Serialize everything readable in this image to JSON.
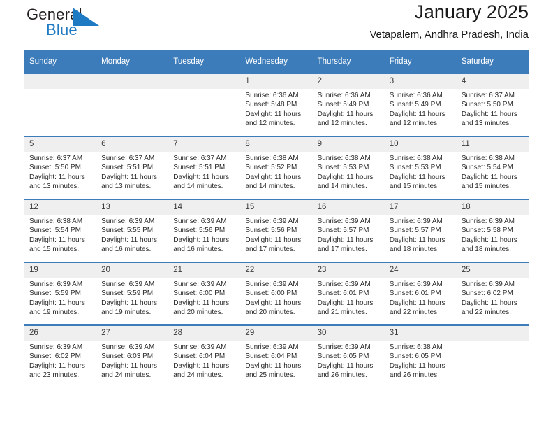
{
  "logo": {
    "word_one": "General",
    "word_two": "Blue",
    "triangle_color": "#1f7ac4",
    "text_color": "#231f20"
  },
  "header": {
    "title": "January 2025",
    "subtitle": "Vetapalem, Andhra Pradesh, India"
  },
  "theme": {
    "header_blue": "#3c7cba",
    "daynum_band": "#efefef",
    "text": "#2b2b2b"
  },
  "weekdays": [
    "Sunday",
    "Monday",
    "Tuesday",
    "Wednesday",
    "Thursday",
    "Friday",
    "Saturday"
  ],
  "weeks": [
    [
      {
        "day": "",
        "sunrise": "",
        "sunset": "",
        "daylight_1": "",
        "daylight_2": ""
      },
      {
        "day": "",
        "sunrise": "",
        "sunset": "",
        "daylight_1": "",
        "daylight_2": ""
      },
      {
        "day": "",
        "sunrise": "",
        "sunset": "",
        "daylight_1": "",
        "daylight_2": ""
      },
      {
        "day": "1",
        "sunrise": "Sunrise: 6:36 AM",
        "sunset": "Sunset: 5:48 PM",
        "daylight_1": "Daylight: 11 hours",
        "daylight_2": "and 12 minutes."
      },
      {
        "day": "2",
        "sunrise": "Sunrise: 6:36 AM",
        "sunset": "Sunset: 5:49 PM",
        "daylight_1": "Daylight: 11 hours",
        "daylight_2": "and 12 minutes."
      },
      {
        "day": "3",
        "sunrise": "Sunrise: 6:36 AM",
        "sunset": "Sunset: 5:49 PM",
        "daylight_1": "Daylight: 11 hours",
        "daylight_2": "and 12 minutes."
      },
      {
        "day": "4",
        "sunrise": "Sunrise: 6:37 AM",
        "sunset": "Sunset: 5:50 PM",
        "daylight_1": "Daylight: 11 hours",
        "daylight_2": "and 13 minutes."
      }
    ],
    [
      {
        "day": "5",
        "sunrise": "Sunrise: 6:37 AM",
        "sunset": "Sunset: 5:50 PM",
        "daylight_1": "Daylight: 11 hours",
        "daylight_2": "and 13 minutes."
      },
      {
        "day": "6",
        "sunrise": "Sunrise: 6:37 AM",
        "sunset": "Sunset: 5:51 PM",
        "daylight_1": "Daylight: 11 hours",
        "daylight_2": "and 13 minutes."
      },
      {
        "day": "7",
        "sunrise": "Sunrise: 6:37 AM",
        "sunset": "Sunset: 5:51 PM",
        "daylight_1": "Daylight: 11 hours",
        "daylight_2": "and 14 minutes."
      },
      {
        "day": "8",
        "sunrise": "Sunrise: 6:38 AM",
        "sunset": "Sunset: 5:52 PM",
        "daylight_1": "Daylight: 11 hours",
        "daylight_2": "and 14 minutes."
      },
      {
        "day": "9",
        "sunrise": "Sunrise: 6:38 AM",
        "sunset": "Sunset: 5:53 PM",
        "daylight_1": "Daylight: 11 hours",
        "daylight_2": "and 14 minutes."
      },
      {
        "day": "10",
        "sunrise": "Sunrise: 6:38 AM",
        "sunset": "Sunset: 5:53 PM",
        "daylight_1": "Daylight: 11 hours",
        "daylight_2": "and 15 minutes."
      },
      {
        "day": "11",
        "sunrise": "Sunrise: 6:38 AM",
        "sunset": "Sunset: 5:54 PM",
        "daylight_1": "Daylight: 11 hours",
        "daylight_2": "and 15 minutes."
      }
    ],
    [
      {
        "day": "12",
        "sunrise": "Sunrise: 6:38 AM",
        "sunset": "Sunset: 5:54 PM",
        "daylight_1": "Daylight: 11 hours",
        "daylight_2": "and 15 minutes."
      },
      {
        "day": "13",
        "sunrise": "Sunrise: 6:39 AM",
        "sunset": "Sunset: 5:55 PM",
        "daylight_1": "Daylight: 11 hours",
        "daylight_2": "and 16 minutes."
      },
      {
        "day": "14",
        "sunrise": "Sunrise: 6:39 AM",
        "sunset": "Sunset: 5:56 PM",
        "daylight_1": "Daylight: 11 hours",
        "daylight_2": "and 16 minutes."
      },
      {
        "day": "15",
        "sunrise": "Sunrise: 6:39 AM",
        "sunset": "Sunset: 5:56 PM",
        "daylight_1": "Daylight: 11 hours",
        "daylight_2": "and 17 minutes."
      },
      {
        "day": "16",
        "sunrise": "Sunrise: 6:39 AM",
        "sunset": "Sunset: 5:57 PM",
        "daylight_1": "Daylight: 11 hours",
        "daylight_2": "and 17 minutes."
      },
      {
        "day": "17",
        "sunrise": "Sunrise: 6:39 AM",
        "sunset": "Sunset: 5:57 PM",
        "daylight_1": "Daylight: 11 hours",
        "daylight_2": "and 18 minutes."
      },
      {
        "day": "18",
        "sunrise": "Sunrise: 6:39 AM",
        "sunset": "Sunset: 5:58 PM",
        "daylight_1": "Daylight: 11 hours",
        "daylight_2": "and 18 minutes."
      }
    ],
    [
      {
        "day": "19",
        "sunrise": "Sunrise: 6:39 AM",
        "sunset": "Sunset: 5:59 PM",
        "daylight_1": "Daylight: 11 hours",
        "daylight_2": "and 19 minutes."
      },
      {
        "day": "20",
        "sunrise": "Sunrise: 6:39 AM",
        "sunset": "Sunset: 5:59 PM",
        "daylight_1": "Daylight: 11 hours",
        "daylight_2": "and 19 minutes."
      },
      {
        "day": "21",
        "sunrise": "Sunrise: 6:39 AM",
        "sunset": "Sunset: 6:00 PM",
        "daylight_1": "Daylight: 11 hours",
        "daylight_2": "and 20 minutes."
      },
      {
        "day": "22",
        "sunrise": "Sunrise: 6:39 AM",
        "sunset": "Sunset: 6:00 PM",
        "daylight_1": "Daylight: 11 hours",
        "daylight_2": "and 20 minutes."
      },
      {
        "day": "23",
        "sunrise": "Sunrise: 6:39 AM",
        "sunset": "Sunset: 6:01 PM",
        "daylight_1": "Daylight: 11 hours",
        "daylight_2": "and 21 minutes."
      },
      {
        "day": "24",
        "sunrise": "Sunrise: 6:39 AM",
        "sunset": "Sunset: 6:01 PM",
        "daylight_1": "Daylight: 11 hours",
        "daylight_2": "and 22 minutes."
      },
      {
        "day": "25",
        "sunrise": "Sunrise: 6:39 AM",
        "sunset": "Sunset: 6:02 PM",
        "daylight_1": "Daylight: 11 hours",
        "daylight_2": "and 22 minutes."
      }
    ],
    [
      {
        "day": "26",
        "sunrise": "Sunrise: 6:39 AM",
        "sunset": "Sunset: 6:02 PM",
        "daylight_1": "Daylight: 11 hours",
        "daylight_2": "and 23 minutes."
      },
      {
        "day": "27",
        "sunrise": "Sunrise: 6:39 AM",
        "sunset": "Sunset: 6:03 PM",
        "daylight_1": "Daylight: 11 hours",
        "daylight_2": "and 24 minutes."
      },
      {
        "day": "28",
        "sunrise": "Sunrise: 6:39 AM",
        "sunset": "Sunset: 6:04 PM",
        "daylight_1": "Daylight: 11 hours",
        "daylight_2": "and 24 minutes."
      },
      {
        "day": "29",
        "sunrise": "Sunrise: 6:39 AM",
        "sunset": "Sunset: 6:04 PM",
        "daylight_1": "Daylight: 11 hours",
        "daylight_2": "and 25 minutes."
      },
      {
        "day": "30",
        "sunrise": "Sunrise: 6:39 AM",
        "sunset": "Sunset: 6:05 PM",
        "daylight_1": "Daylight: 11 hours",
        "daylight_2": "and 26 minutes."
      },
      {
        "day": "31",
        "sunrise": "Sunrise: 6:38 AM",
        "sunset": "Sunset: 6:05 PM",
        "daylight_1": "Daylight: 11 hours",
        "daylight_2": "and 26 minutes."
      },
      {
        "day": "",
        "sunrise": "",
        "sunset": "",
        "daylight_1": "",
        "daylight_2": ""
      }
    ]
  ]
}
